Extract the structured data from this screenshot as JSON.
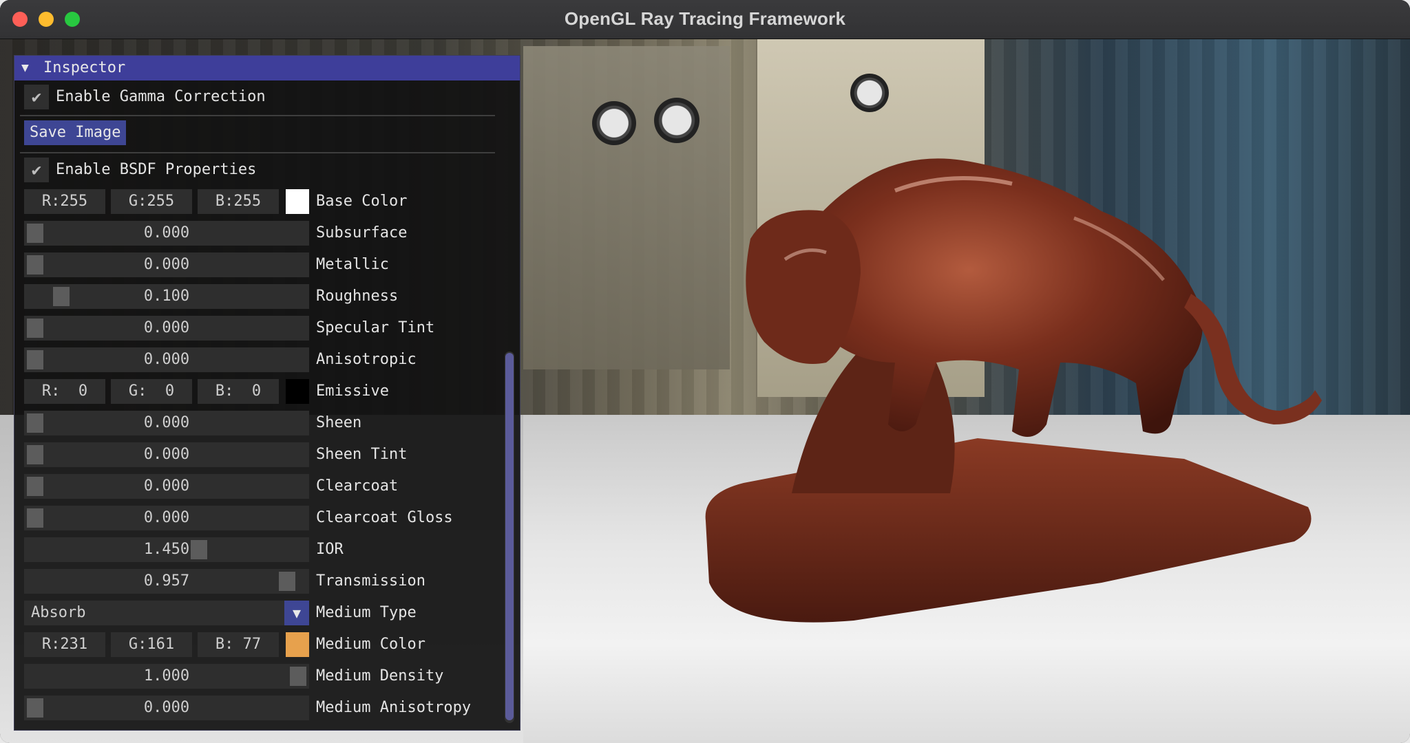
{
  "window": {
    "title": "OpenGL Ray Tracing Framework"
  },
  "inspector": {
    "title": "Inspector",
    "gamma": {
      "label": "Enable Gamma Correction",
      "checked": true
    },
    "save_label": "Save Image",
    "bsdf": {
      "label": "Enable BSDF Properties",
      "checked": true
    },
    "base_color": {
      "r": "R:255",
      "g": "G:255",
      "b": "B:255",
      "label": "Base Color",
      "swatch": "#ffffff"
    },
    "subsurface": {
      "value": "0.000",
      "label": "Subsurface",
      "fraction": 0.0
    },
    "metallic": {
      "value": "0.000",
      "label": "Metallic",
      "fraction": 0.0
    },
    "roughness": {
      "value": "0.100",
      "label": "Roughness",
      "fraction": 0.1
    },
    "specular_tint": {
      "value": "0.000",
      "label": "Specular Tint",
      "fraction": 0.0
    },
    "anisotropic": {
      "value": "0.000",
      "label": "Anisotropic",
      "fraction": 0.0
    },
    "emissive": {
      "r": "R:  0",
      "g": "G:  0",
      "b": "B:  0",
      "label": "Emissive",
      "swatch": "#000000"
    },
    "sheen": {
      "value": "0.000",
      "label": "Sheen",
      "fraction": 0.0
    },
    "sheen_tint": {
      "value": "0.000",
      "label": "Sheen Tint",
      "fraction": 0.0
    },
    "clearcoat": {
      "value": "0.000",
      "label": "Clearcoat",
      "fraction": 0.0
    },
    "clearcoat_gloss": {
      "value": "0.000",
      "label": "Clearcoat Gloss",
      "fraction": 0.0
    },
    "ior": {
      "value": "1.450",
      "label": "IOR",
      "fraction": 0.5
    },
    "transmission": {
      "value": "0.957",
      "label": "Transmission",
      "fraction": 0.957
    },
    "medium_type": {
      "value": "Absorb",
      "label": "Medium Type"
    },
    "medium_color": {
      "r": "R:231",
      "g": "G:161",
      "b": "B: 77",
      "label": "Medium Color",
      "swatch": "#e7a14d"
    },
    "medium_density": {
      "value": "1.000",
      "label": "Medium Density",
      "fraction": 1.0
    },
    "medium_anisotropy": {
      "value": "0.000",
      "label": "Medium Anisotropy",
      "fraction": 0.0
    }
  }
}
